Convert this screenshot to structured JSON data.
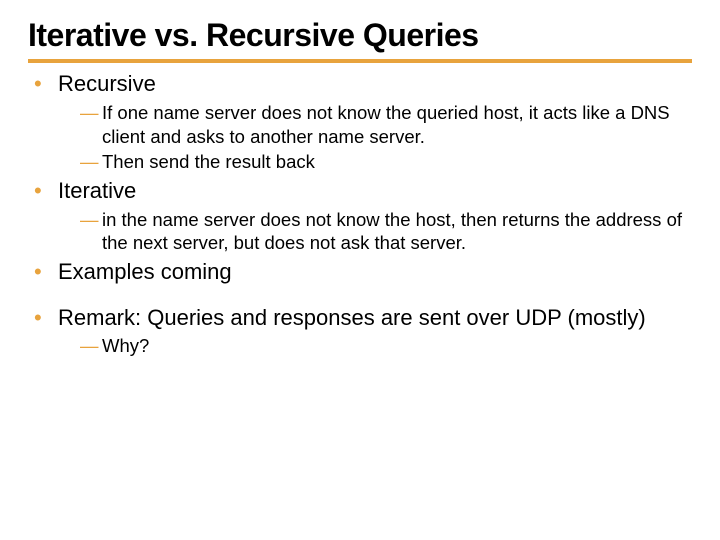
{
  "title": "Iterative vs. Recursive Queries",
  "bullets": [
    {
      "label": "Recursive",
      "sub": [
        "If one name server does not know the queried host, it acts like a DNS client and asks to another name server.",
        "Then send the result back"
      ]
    },
    {
      "label": "Iterative",
      "sub": [
        "in the name server does not know the host, then returns the address of the next server, but does not ask that server."
      ]
    },
    {
      "label": "Examples coming",
      "sub": []
    },
    {
      "label": "Remark: Queries and responses are sent over UDP (mostly)",
      "sub": [
        "Why?"
      ]
    }
  ]
}
